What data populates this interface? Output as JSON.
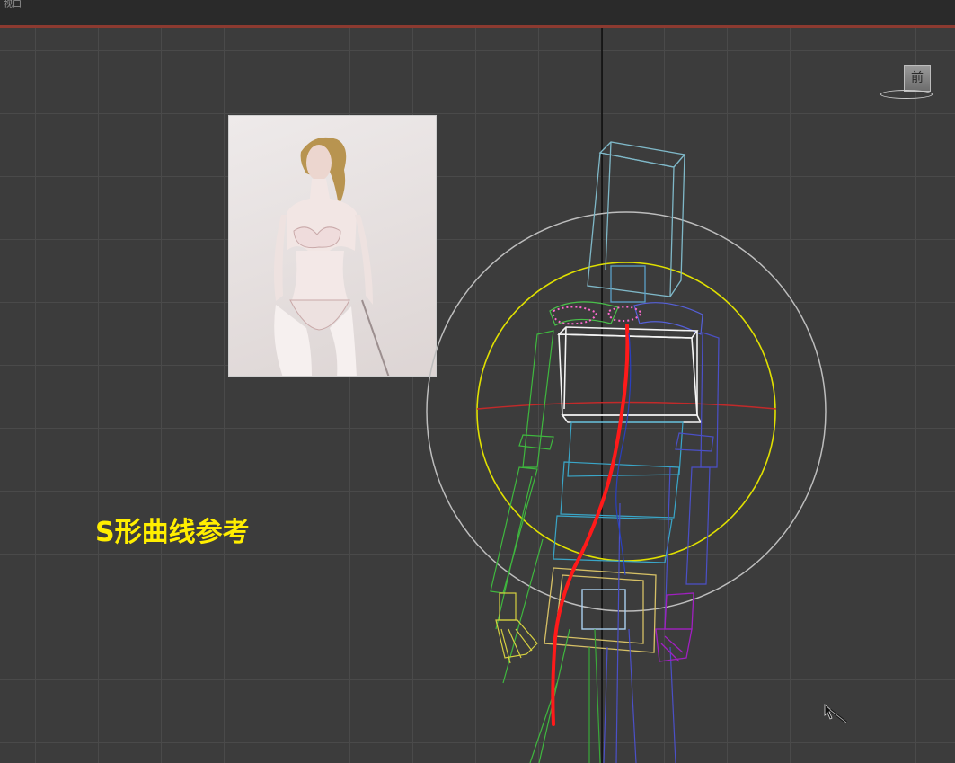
{
  "window": {
    "title": "视口"
  },
  "viewport": {
    "label": "前",
    "caption": "S形曲线参考"
  },
  "icons": {
    "viewcube": "viewcube-icon",
    "cursor": "mouse-cursor-icon"
  },
  "colors": {
    "background": "#3c3c3c",
    "grid": "#4a4a4a",
    "caption": "#ffee00",
    "s_curve": "#ff1a1a",
    "selection_circle": "#e6e600",
    "outer_circle": "#bfbfbf"
  }
}
